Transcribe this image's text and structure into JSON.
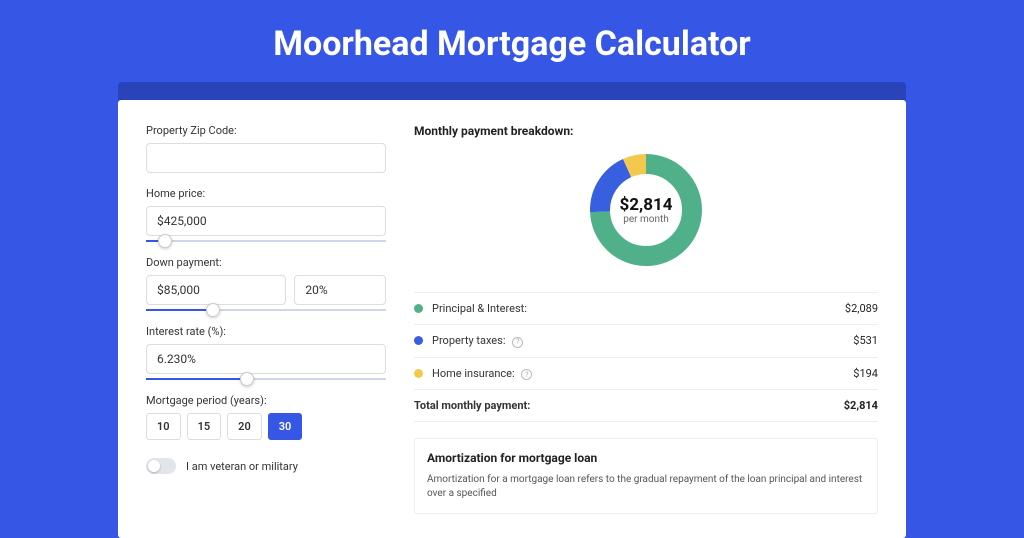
{
  "title": "Moorhead Mortgage Calculator",
  "left": {
    "zip_label": "Property Zip Code:",
    "zip_value": "",
    "home_price_label": "Home price:",
    "home_price_value": "$425,000",
    "home_price_slider_pct": 8,
    "down_label": "Down payment:",
    "down_value": "$85,000",
    "down_pct_value": "20%",
    "down_slider_pct": 28,
    "rate_label": "Interest rate (%):",
    "rate_value": "6.230%",
    "rate_slider_pct": 42,
    "period_label": "Mortgage period (years):",
    "periods": [
      "10",
      "15",
      "20",
      "30"
    ],
    "period_active_index": 3,
    "veteran_label": "I am veteran or military"
  },
  "right": {
    "breakdown_title": "Monthly payment breakdown:",
    "total_amount": "$2,814",
    "per_month": "per month",
    "rows": [
      {
        "label": "Principal & Interest:",
        "value": "$2,089",
        "color": "#4FB08A",
        "has_info": false
      },
      {
        "label": "Property taxes:",
        "value": "$531",
        "color": "#385FE0",
        "has_info": true
      },
      {
        "label": "Home insurance:",
        "value": "$194",
        "color": "#F2C94C",
        "has_info": true
      }
    ],
    "total_label": "Total monthly payment:",
    "total_value": "$2,814",
    "amort_title": "Amortization for mortgage loan",
    "amort_text": "Amortization for a mortgage loan refers to the gradual repayment of the loan principal and interest over a specified"
  },
  "chart_data": {
    "type": "pie",
    "title": "Monthly payment breakdown",
    "series": [
      {
        "name": "Principal & Interest",
        "value": 2089,
        "color": "#4FB08A"
      },
      {
        "name": "Property taxes",
        "value": 531,
        "color": "#385FE0"
      },
      {
        "name": "Home insurance",
        "value": 194,
        "color": "#F2C94C"
      }
    ],
    "total": 2814,
    "center_label": "$2,814",
    "center_sub": "per month"
  }
}
